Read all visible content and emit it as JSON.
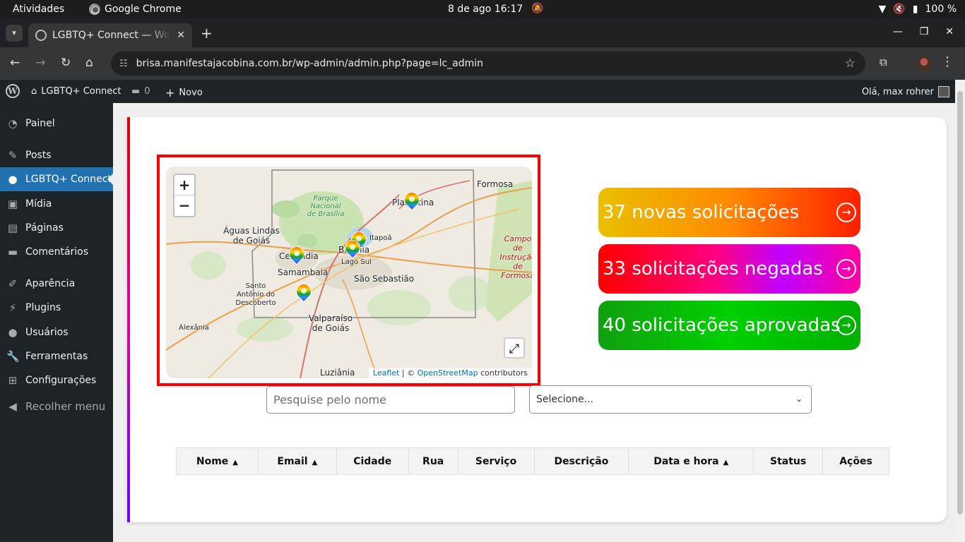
{
  "os": {
    "activities": "Atividades",
    "app_name": "Google Chrome",
    "clock": "8 de ago  16:17",
    "battery": "100 %"
  },
  "browser": {
    "tab_title": "LGBTQ+ Connect — WordPress",
    "url": "brisa.manifestajacobina.com.br/wp-admin/admin.php?page=lc_admin"
  },
  "adminbar": {
    "site_name": "LGBTQ+ Connect",
    "comments_count": "0",
    "new_label": "Novo",
    "howdy": "Olá, max rohrer"
  },
  "sidebar": {
    "items": [
      {
        "label": "Painel",
        "icon": "dashboard-icon"
      },
      {
        "label": "Posts",
        "icon": "pin-icon"
      },
      {
        "label": "LGBTQ+ Connect",
        "icon": "user-icon"
      },
      {
        "label": "Mídia",
        "icon": "media-icon"
      },
      {
        "label": "Páginas",
        "icon": "page-icon"
      },
      {
        "label": "Comentários",
        "icon": "comment-icon"
      },
      {
        "label": "Aparência",
        "icon": "brush-icon"
      },
      {
        "label": "Plugins",
        "icon": "plugin-icon"
      },
      {
        "label": "Usuários",
        "icon": "users-icon"
      },
      {
        "label": "Ferramentas",
        "icon": "wrench-icon"
      },
      {
        "label": "Configurações",
        "icon": "settings-icon"
      },
      {
        "label": "Recolher menu",
        "icon": "collapse-icon"
      }
    ]
  },
  "map": {
    "zoom_in": "+",
    "zoom_out": "−",
    "places": [
      "Formosa",
      "Parque Nacional de Brasília",
      "Planaltina",
      "Águas Lindas de Goiás",
      "Itapoã",
      "Ceilândia",
      "Brasília",
      "Lago Sul",
      "Samambaia",
      "São Sebastião",
      "Santo Antônio do Descoberto",
      "Valparaíso de Goiás",
      "Alexânia",
      "Luziânia",
      "Campo de Instrução de Formosa"
    ],
    "attribution_leaflet": "Leaflet",
    "attribution_sep": " | © ",
    "attribution_osm": "OpenStreetMap",
    "attribution_tail": " contributors"
  },
  "stats": {
    "new": "37 novas solicitações",
    "denied": "33 solicitações negadas",
    "approved": "40 solicitações aprovadas"
  },
  "filters": {
    "search_placeholder": "Pesquise pelo nome",
    "select_value": "Selecione..."
  },
  "table": {
    "columns": [
      "Nome",
      "Email",
      "Cidade",
      "Rua",
      "Serviço",
      "Descrição",
      "Data e hora",
      "Status",
      "Ações"
    ]
  },
  "colors": {
    "accent": "#2271b1",
    "sidebar_bg": "#1d2327",
    "highlight_frame": "#ff0000"
  }
}
